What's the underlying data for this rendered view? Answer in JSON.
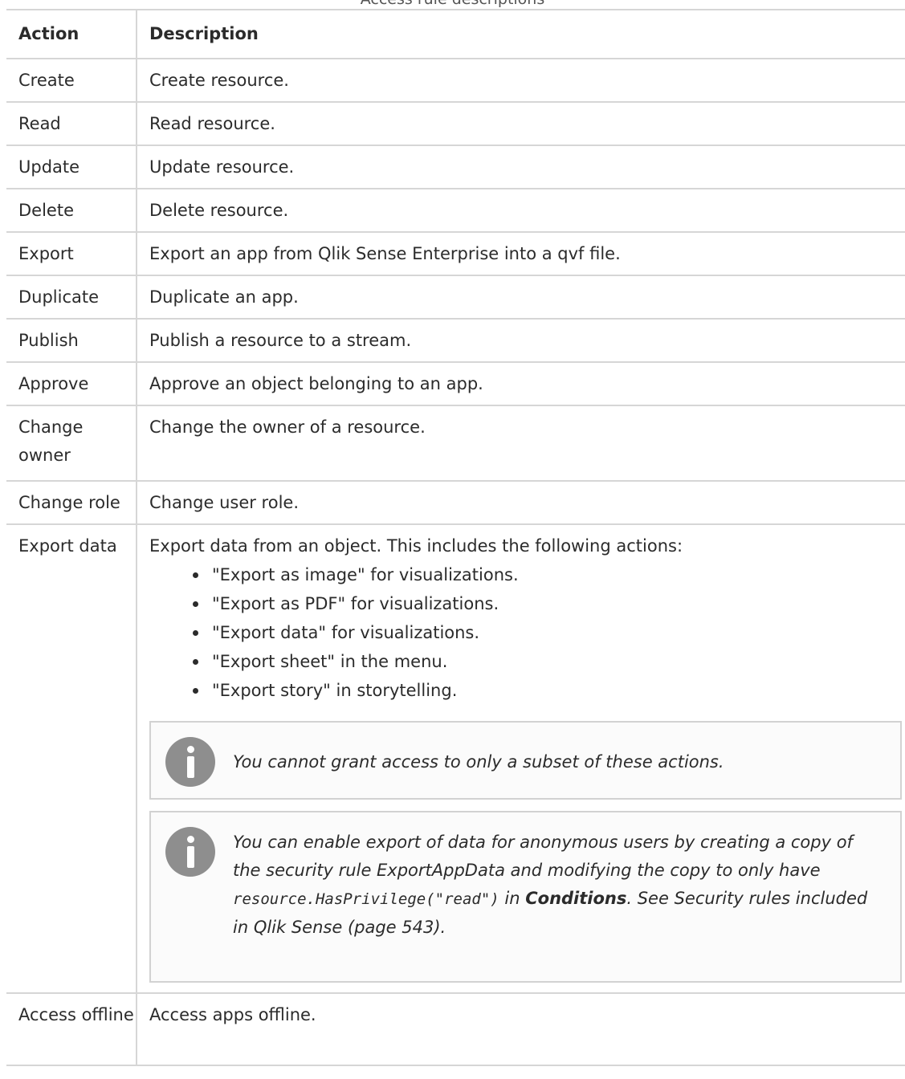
{
  "caption": "Access rule descriptions",
  "table": {
    "headers": {
      "action": "Action",
      "description": "Description"
    },
    "rows": [
      {
        "action": "Create",
        "description": "Create resource."
      },
      {
        "action": "Read",
        "description": "Read resource."
      },
      {
        "action": "Update",
        "description": "Update resource."
      },
      {
        "action": "Delete",
        "description": "Delete resource."
      },
      {
        "action": "Export",
        "description": "Export an app from Qlik Sense Enterprise into a qvf file."
      },
      {
        "action": "Duplicate",
        "description": "Duplicate an app."
      },
      {
        "action": "Publish",
        "description": "Publish a resource to a stream."
      },
      {
        "action": "Approve",
        "description": "Approve an object belonging to an app."
      },
      {
        "action": "Change owner",
        "description": "Change the owner of a resource."
      },
      {
        "action": "Change role",
        "description": "Change user role."
      },
      {
        "action": "Export data",
        "description": "Export data from an object. This includes the following actions:"
      },
      {
        "action": "Access offline",
        "description": "Access apps offline."
      }
    ],
    "export_data": {
      "bullets": [
        "\"Export as image\" for visualizations.",
        "\"Export as PDF\" for visualizations.",
        "\"Export data\" for visualizations.",
        "\"Export sheet\" in the menu.",
        "\"Export story\" in storytelling."
      ],
      "note1": "You cannot grant access to only a subset of these actions.",
      "note2": {
        "text_a": "You can enable export of data for anonymous users by creating a copy of the security rule ExportAppData and modifying the copy to only have ",
        "code": "resource.HasPrivilege(\"read\")",
        "text_b": " in ",
        "bold": "Conditions",
        "text_c": ". See Security rules included in Qlik Sense (page 543)."
      }
    }
  }
}
